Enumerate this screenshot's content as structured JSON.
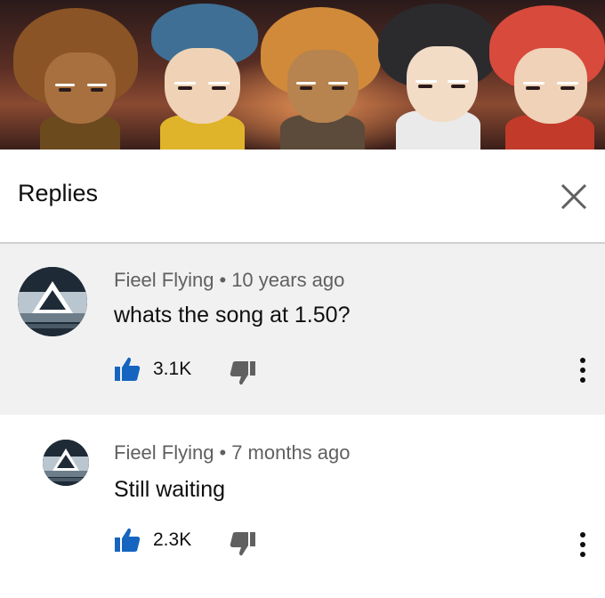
{
  "header": {
    "title": "Replies",
    "close_icon": "close-icon"
  },
  "comments": [
    {
      "author": "Fieel Flying",
      "separator": "•",
      "time": "10 years ago",
      "text": "whats the song at 1.50?",
      "likes": "3.1K",
      "icons": [
        "thumbs-up-icon",
        "thumbs-down-icon",
        "more-vertical-icon"
      ]
    },
    {
      "author": "Fieel Flying",
      "separator": "•",
      "time": "7 months ago",
      "text": "Still waiting",
      "likes": "2.3K",
      "icons": [
        "thumbs-up-icon",
        "thumbs-down-icon",
        "more-vertical-icon"
      ]
    }
  ],
  "colors": {
    "like_blue": "#1565c0",
    "icon_gray": "#606060",
    "text_primary": "#0f0f0f",
    "highlight_bg": "#f1f1f1"
  }
}
